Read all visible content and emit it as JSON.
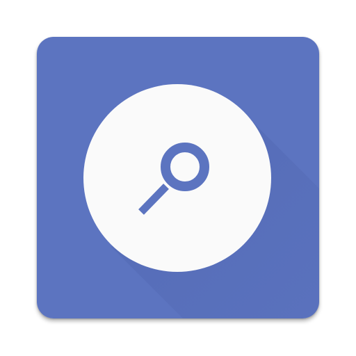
{
  "app_icon": {
    "name": "search-app-icon",
    "glyph": "magnifier-icon",
    "colors": {
      "background": "#5C74C0",
      "long_shadow": "#4E64AE",
      "disc": "#FAFAFA",
      "glyph": "#5C74C0"
    }
  }
}
